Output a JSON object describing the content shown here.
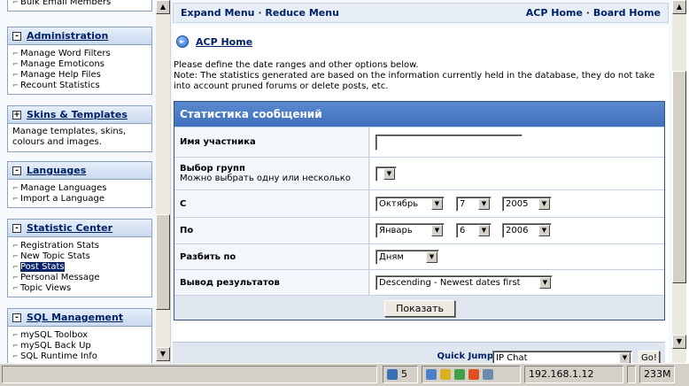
{
  "left_menu": {
    "partial_top_item": "Bulk Email Members",
    "sections": [
      {
        "title": "Administration",
        "expander": "-",
        "items": [
          "Manage Word Filters",
          "Manage Emoticons",
          "Manage Help Files",
          "Recount Statistics"
        ]
      },
      {
        "title": "Skins & Templates",
        "expander": "+",
        "description": "Manage templates, skins, colours and images."
      },
      {
        "title": "Languages",
        "expander": "-",
        "items": [
          "Manage Languages",
          "Import a Language"
        ]
      },
      {
        "title": "Statistic Center",
        "expander": "-",
        "items": [
          "Registration Stats",
          "New Topic Stats",
          "Post Stats",
          "Personal Message",
          "Topic Views"
        ],
        "selected": "Post Stats"
      },
      {
        "title": "SQL Management",
        "expander": "-",
        "items": [
          "mySQL Toolbox",
          "mySQL Back Up",
          "SQL Runtime Info"
        ]
      }
    ]
  },
  "topnav": {
    "expand": "Expand Menu",
    "reduce": "Reduce Menu",
    "acp_home": "ACP Home",
    "board_home": "Board Home",
    "sep": "·"
  },
  "page": {
    "title": "ACP Home",
    "intro_line1": "Please define the date ranges and other options below.",
    "intro_line2": "Note: The statistics generated are based on the information currently held in the database, they do not take into account pruned forums or delete posts, etc."
  },
  "form": {
    "header": "Статистика сообщений",
    "member_label": "Имя участника",
    "member_value": "",
    "groups_label": "Выбор групп",
    "groups_sub": "Можно выбрать одну или несколько",
    "from_label": "С",
    "from_month": "Октябрь",
    "from_day": "7",
    "from_year": "2005",
    "to_label": "По",
    "to_month": "Январь",
    "to_day": "6",
    "to_year": "2006",
    "split_label": "Разбить по",
    "split_value": "Дням",
    "output_label": "Вывод результатов",
    "output_value": "Descending - Newest dates first",
    "submit": "Показать"
  },
  "quick_jump": {
    "label": "Quick Jump",
    "value": "IP Chat",
    "go": "Go!"
  },
  "statusbar": {
    "count": "5",
    "ip": "192.168.1.12",
    "memory": "233M"
  }
}
